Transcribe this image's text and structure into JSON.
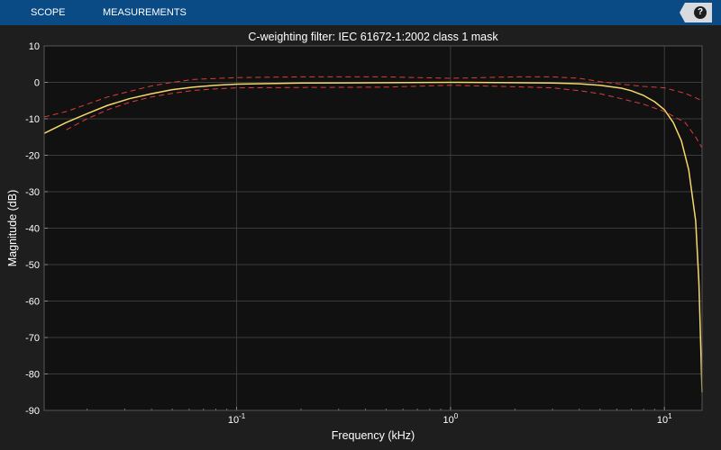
{
  "toolbar": {
    "tabs": [
      "SCOPE",
      "MEASUREMENTS"
    ],
    "help_icon": "help-icon",
    "help_glyph": "?"
  },
  "chart_data": {
    "type": "line",
    "title": "C-weighting filter: IEC 61672-1:2002 class 1 mask",
    "xlabel": "Frequency (kHz)",
    "ylabel": "Magnitude (dB)",
    "xscale": "log",
    "xlim": [
      0.0126,
      15
    ],
    "ylim": [
      -90,
      10
    ],
    "grid": true,
    "yticks": [
      10,
      0,
      -10,
      -20,
      -30,
      -40,
      -50,
      -60,
      -70,
      -80,
      -90
    ],
    "ytick_labels": [
      "10",
      "0",
      "-10",
      "-20",
      "-30",
      "-40",
      "-50",
      "-60",
      "-70",
      "-80",
      "-90"
    ],
    "xticks": [
      {
        "value": 0.1,
        "base": "10",
        "exp": "-1"
      },
      {
        "value": 1,
        "base": "10",
        "exp": "0"
      },
      {
        "value": 10,
        "base": "10",
        "exp": "1"
      }
    ],
    "colors": {
      "response": "#f5d86a",
      "mask": "#e03b3b",
      "axes_bg": "#111111",
      "grid": "#3c3c3c"
    },
    "series": [
      {
        "style": "solid",
        "x": [
          0.0126,
          0.016,
          0.02,
          0.025,
          0.0315,
          0.04,
          0.05,
          0.063,
          0.08,
          0.1,
          0.2,
          0.5,
          1,
          2,
          3,
          4,
          5,
          6.3,
          7,
          8,
          9,
          10,
          11,
          12,
          13,
          14,
          14.5,
          15
        ],
        "y": [
          -14,
          -11,
          -8.6,
          -6.3,
          -4.5,
          -3.1,
          -2,
          -1.3,
          -0.8,
          -0.5,
          -0.2,
          -0.1,
          0,
          -0.1,
          -0.2,
          -0.4,
          -0.8,
          -1.6,
          -2.3,
          -3.6,
          -5.3,
          -7.5,
          -11,
          -16,
          -24,
          -38,
          -55,
          -85
        ]
      },
      {
        "style": "dashed",
        "x": [
          0.0126,
          0.016,
          0.02,
          0.025,
          0.0315,
          0.04,
          0.05,
          0.063,
          0.1,
          0.2,
          0.5,
          1,
          2,
          3,
          4,
          5,
          6.3,
          8,
          10,
          12.5,
          15
        ],
        "y": [
          -9.5,
          -8,
          -6,
          -4,
          -2.5,
          -1,
          0,
          0.8,
          1.3,
          1.5,
          1.5,
          1.1,
          1.5,
          1.5,
          1.1,
          0.2,
          -0.5,
          -1.1,
          -1.5,
          -3,
          -5
        ]
      },
      {
        "style": "dashed",
        "x": [
          0.016,
          0.02,
          0.025,
          0.0315,
          0.04,
          0.05,
          0.063,
          0.08,
          0.1,
          0.2,
          0.5,
          1,
          2,
          3,
          4,
          5,
          6.3,
          8,
          10,
          12.5,
          14,
          15
        ],
        "y": [
          -13,
          -10,
          -7.5,
          -5.5,
          -4,
          -3,
          -2.2,
          -1.8,
          -1.5,
          -1.4,
          -1.3,
          -0.8,
          -1.2,
          -1.5,
          -2.3,
          -3.1,
          -4.5,
          -6,
          -8,
          -11,
          -15,
          -18
        ]
      }
    ]
  }
}
